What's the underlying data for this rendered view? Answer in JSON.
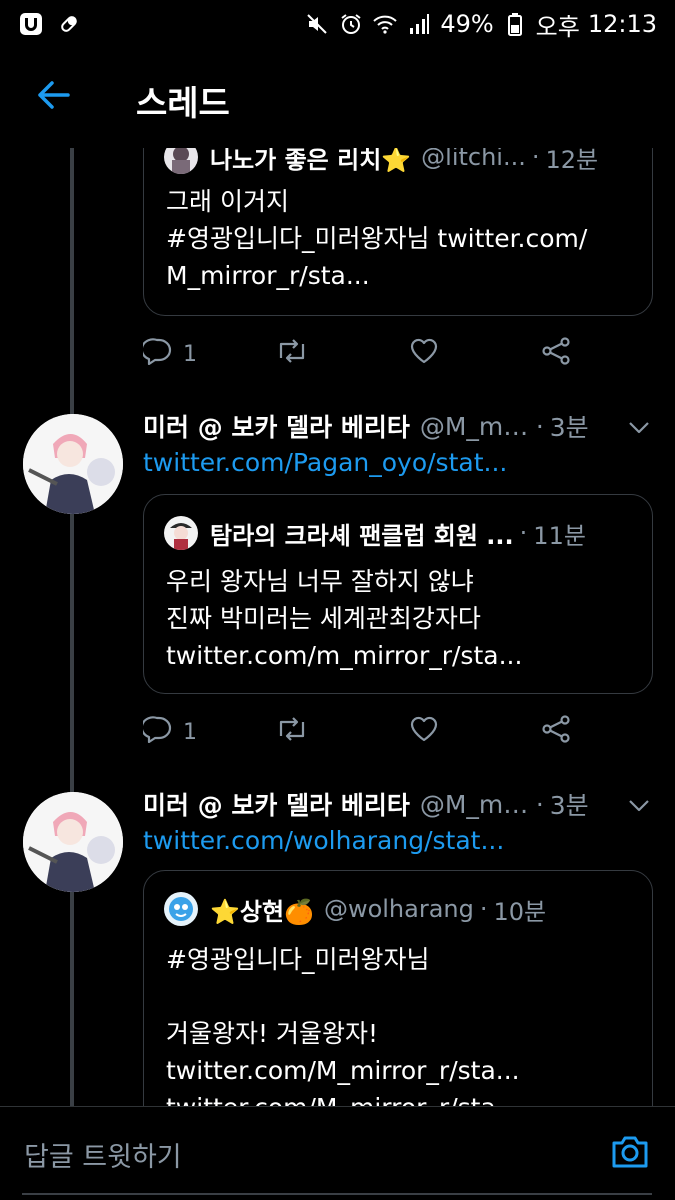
{
  "status_bar": {
    "battery": "49%",
    "period": "오후",
    "time": "12:13",
    "icons": [
      "u-plus-icon",
      "pill-icon",
      "mute-icon",
      "alarm-icon",
      "wifi-icon",
      "signal-icon",
      "battery-icon"
    ]
  },
  "header": {
    "title": "스레드",
    "back_icon": "arrow-left-icon",
    "accent_color": "#1d9bf0"
  },
  "tweets": [
    {
      "quote": {
        "name": "나노가 좋은 리치⭐",
        "handle": "@litchi...",
        "time": "12분",
        "text": "그래 이거지\n#영광입니다_미러왕자님 twitter.com/\nM_mirror_r/sta..."
      },
      "reply_count": "1"
    },
    {
      "name": "미러 @ 보카 델라 베리타",
      "handle": "@M_mi...",
      "time": "3분",
      "link": "twitter.com/Pagan_oyo/stat...",
      "quote": {
        "name": "탐라의 크라셰 팬클럽 회원 ...",
        "handle": "",
        "time": "11분",
        "text": "우리 왕자님 너무 잘하지 않냐\n진짜 박미러는 세계관최강자다\ntwitter.com/m_mirror_r/sta..."
      },
      "reply_count": "1"
    },
    {
      "name": "미러 @ 보카 델라 베리타",
      "handle": "@M_mi...",
      "time": "3분",
      "link": "twitter.com/wolharang/stat...",
      "quote": {
        "name": "⭐상현🍊",
        "handle": "@wolharang",
        "time": "10분",
        "text": "#영광입니다_미러왕자님\n\n거울왕자! 거울왕자!\ntwitter.com/M_mirror_r/sta...\ntwitter.com/M_mirror_r/sta..."
      }
    }
  ],
  "reply_bar": {
    "placeholder": "답글 트윗하기",
    "camera_icon": "camera-icon"
  },
  "dot": "·"
}
